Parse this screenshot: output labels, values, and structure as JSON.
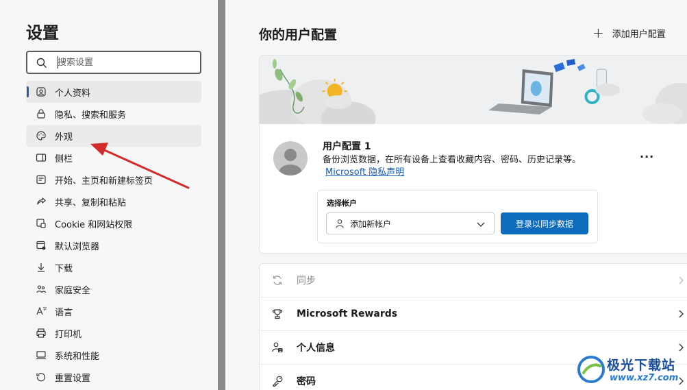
{
  "sidebar": {
    "title": "设置",
    "search": {
      "placeholder": "搜索设置",
      "value": ""
    },
    "items": [
      {
        "label": "个人资料",
        "icon": "profile-icon"
      },
      {
        "label": "隐私、搜索和服务",
        "icon": "lock-icon"
      },
      {
        "label": "外观",
        "icon": "palette-icon"
      },
      {
        "label": "侧栏",
        "icon": "sidebar-icon"
      },
      {
        "label": "开始、主页和新建标签页",
        "icon": "home-icon"
      },
      {
        "label": "共享、复制和粘贴",
        "icon": "share-icon"
      },
      {
        "label": "Cookie 和网站权限",
        "icon": "cookie-icon"
      },
      {
        "label": "默认浏览器",
        "icon": "browser-icon"
      },
      {
        "label": "下载",
        "icon": "download-icon"
      },
      {
        "label": "家庭安全",
        "icon": "family-icon"
      },
      {
        "label": "语言",
        "icon": "language-icon"
      },
      {
        "label": "打印机",
        "icon": "printer-icon"
      },
      {
        "label": "系统和性能",
        "icon": "system-icon"
      },
      {
        "label": "重置设置",
        "icon": "reset-icon"
      }
    ]
  },
  "main": {
    "title": "你的用户配置",
    "add_profile": "添加用户配置",
    "profile": {
      "name": "用户配置 1",
      "description": "备份浏览数据，在所有设备上查看收藏内容、密码、历史记录等。",
      "privacy_link": "Microsoft 隐私声明",
      "more": "···"
    },
    "account": {
      "label": "选择帐户",
      "selected": "添加新帐户",
      "sync_button": "登录以同步数据"
    },
    "rows": [
      {
        "label": "同步",
        "icon": "sync-icon",
        "disabled": true
      },
      {
        "label": "Microsoft Rewards",
        "icon": "trophy-icon",
        "disabled": false
      },
      {
        "label": "个人信息",
        "icon": "personal-info-icon",
        "disabled": false
      },
      {
        "label": "密码",
        "icon": "key-icon",
        "disabled": false
      }
    ]
  },
  "watermark": {
    "name": "极光下载站",
    "url": "www.xz7.com"
  },
  "colors": {
    "accent": "#0f6cbd",
    "active_indicator": "#2b5fa0",
    "arrow": "#d42a2a",
    "link": "#1a5fb4"
  }
}
